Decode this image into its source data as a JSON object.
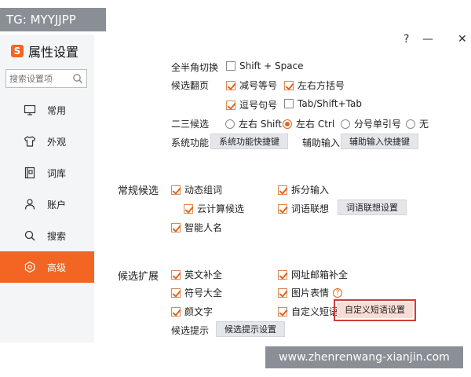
{
  "overlay": {
    "tg": "TG: MYYJJPP",
    "watermark": "www.zhenrenwang-xianjin.com"
  },
  "app": {
    "logo_letter": "S",
    "title": "属性设置"
  },
  "search": {
    "placeholder": "搜索设置项"
  },
  "window": {
    "help": "?",
    "minimize": "—",
    "close": "✕"
  },
  "nav": [
    {
      "label": "常用",
      "icon": "monitor-icon"
    },
    {
      "label": "外观",
      "icon": "shirt-icon"
    },
    {
      "label": "词库",
      "icon": "book-icon"
    },
    {
      "label": "账户",
      "icon": "user-icon"
    },
    {
      "label": "搜索",
      "icon": "search-icon"
    },
    {
      "label": "高级",
      "icon": "gear-icon",
      "active": true
    }
  ],
  "basic": {
    "fullhalf_label": "全半角切换",
    "fullhalf_option": "Shift + Space",
    "page_label": "候选翻页",
    "minus_equal": "减号等号",
    "brackets": "左右方括号",
    "comma_period": "逗号句号",
    "tab": "Tab/Shift+Tab",
    "second_third_label": "二三候选",
    "radio_shift": "左右 Shift",
    "radio_ctrl": "左右 Ctrl",
    "radio_quote": "分号单引号",
    "radio_none": "无",
    "sys_func_label": "系统功能",
    "sys_func_button": "系统功能快捷键",
    "aux_input_label": "辅助输入",
    "aux_input_button": "辅助输入快捷键"
  },
  "general": {
    "section": "常规候选",
    "dynamic_group": "动态组词",
    "split_input": "拆分输入",
    "cloud_calc": "云计算候选",
    "word_assoc": "词语联想",
    "word_assoc_button": "词语联想设置",
    "smart_name": "智能人名"
  },
  "extend": {
    "section": "候选扩展",
    "english": "英文补全",
    "email": "网址邮箱补全",
    "symbols": "符号大全",
    "emoji": "图片表情",
    "kaomoji": "颜文字",
    "custom_phrase": "自定义短语",
    "custom_phrase_button": "自定义短语设置",
    "tips_label": "候选提示",
    "tips_button": "候选提示设置"
  },
  "colors": {
    "accent": "#f26522",
    "highlight": "#d23b3b"
  }
}
